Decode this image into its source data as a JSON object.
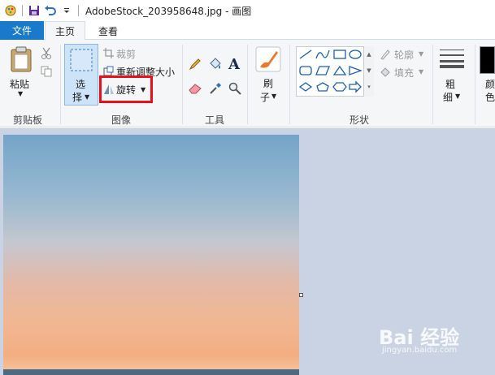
{
  "window": {
    "title": "AdobeStock_203958648.jpg - 画图"
  },
  "tabs": {
    "file": "文件",
    "home": "主页",
    "view": "查看"
  },
  "ribbon": {
    "clipboard": {
      "paste": "粘贴",
      "label": "剪贴板"
    },
    "image": {
      "select_line1": "选",
      "select_line2": "择",
      "crop": "裁剪",
      "resize": "重新调整大小",
      "rotate": "旋转",
      "label": "图像"
    },
    "tools": {
      "label": "工具"
    },
    "brushes": {
      "line1": "刷",
      "line2": "子"
    },
    "shapes": {
      "outline": "轮廓",
      "fill": "填充",
      "label": "形状"
    },
    "size": {
      "line1": "粗",
      "line2": "细"
    },
    "color": {
      "line1": "颜",
      "line2": "色"
    }
  },
  "watermark": {
    "main": "Bai 经验",
    "sub": "jingyan.baidu.com"
  },
  "colors": {
    "accent": "#1979ca",
    "highlight": "#e8101a",
    "canvas_bg": "#c9d3e3"
  }
}
